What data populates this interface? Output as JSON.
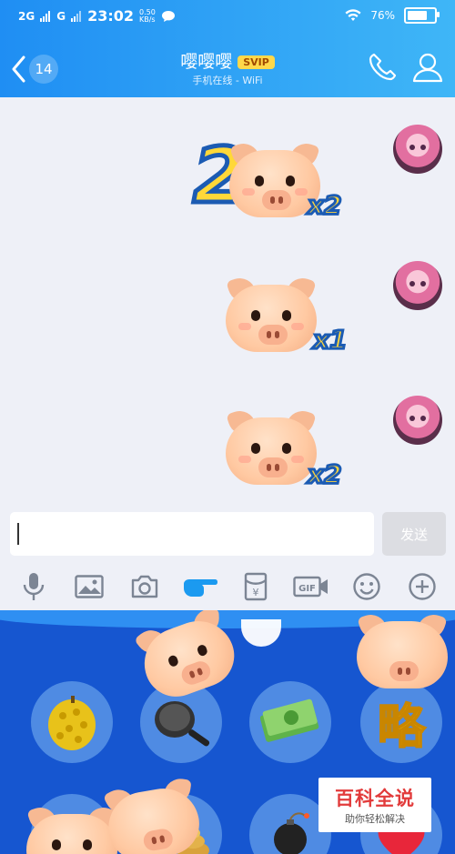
{
  "status_bar": {
    "signal_1": "2G",
    "signal_2": "G",
    "time": "23:02",
    "net_speed_value": "0.50",
    "net_speed_unit": "KB/s",
    "battery": "76%",
    "battery_level_percent": 76
  },
  "header": {
    "back_count": "14",
    "contact_name": "嘤嘤嘤",
    "badge": "SVIP",
    "status_line": "手机在线 - WiFi",
    "icons": [
      "back-chevron-icon",
      "phone-icon",
      "profile-icon"
    ]
  },
  "messages": [
    {
      "sender": "self",
      "sticker": "pig-with-number-2",
      "prefix": "2",
      "multiplier": "x2"
    },
    {
      "sender": "self",
      "sticker": "pig",
      "multiplier": "x1"
    },
    {
      "sender": "self",
      "sticker": "pig",
      "multiplier": "x2"
    }
  ],
  "composer": {
    "placeholder": "",
    "value": "",
    "send_label": "发送"
  },
  "toolbar": {
    "items": [
      "microphone-icon",
      "image-icon",
      "camera-icon",
      "poke-icon",
      "red-packet-icon",
      "gif-icon",
      "emoji-icon",
      "plus-icon"
    ],
    "gif_label": "GIF",
    "red_packet_label": "¥"
  },
  "sticker_panel": {
    "row1": [
      "durian-sticker",
      "frying-pan-sticker",
      "money-sticker",
      "lue-text-sticker"
    ],
    "row2": [
      "pig-sticker",
      "pig-poop-sticker",
      "bomb-sticker",
      "heart-sticker"
    ],
    "lue_text": "略"
  },
  "watermark": {
    "main": "百科全说",
    "sub": "助你轻松解决"
  },
  "colors": {
    "header_start": "#1f8ef3",
    "header_end": "#3fb6f7",
    "panel": "#1656d0",
    "multiplier_fill": "#ffd53c",
    "multiplier_stroke": "#1b5bb3",
    "svip_badge": "#ffd84a"
  }
}
